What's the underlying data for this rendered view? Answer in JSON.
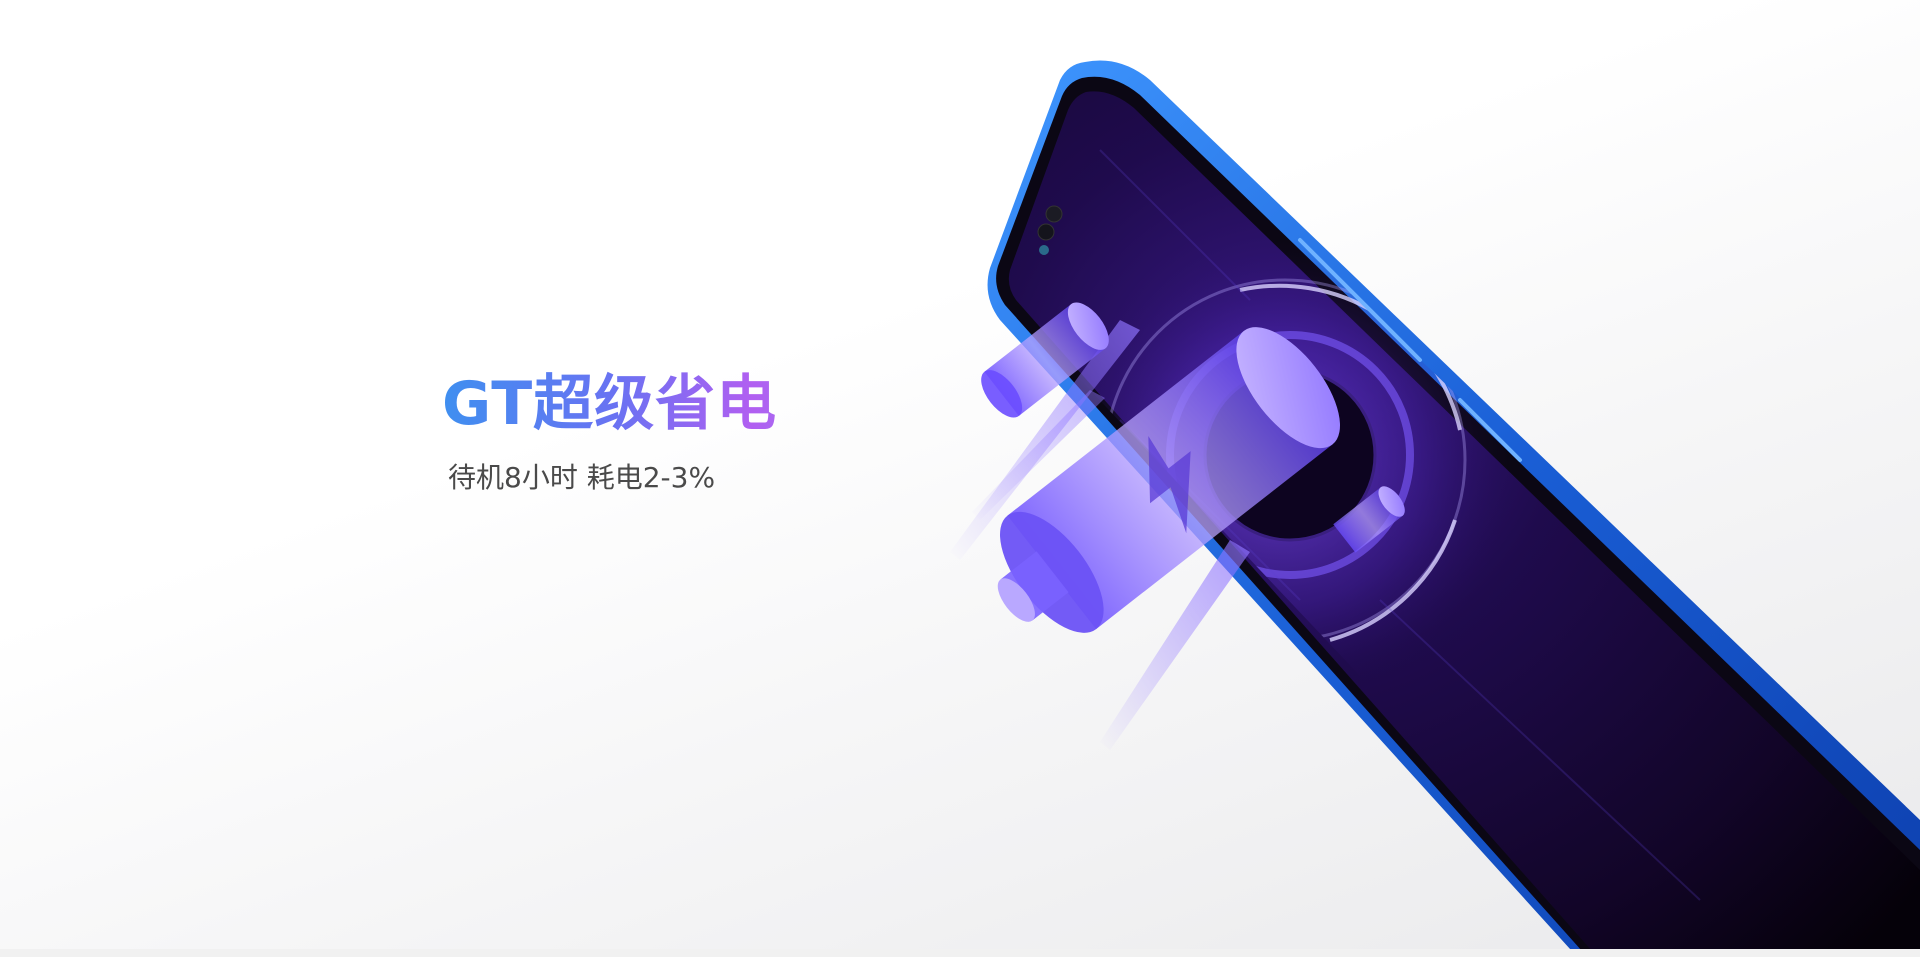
{
  "banner": {
    "headline": "GT超级省电",
    "subline": "待机8小时 耗电2-3%"
  },
  "colors": {
    "background": "#ffffff",
    "headline_gradient_start": "#3f8ff0",
    "headline_gradient_mid": "#b15ff1",
    "headline_gradient_end": "#7fa4f4",
    "subline_text": "#4a4a4a",
    "phone_frame": "#1e6fe0",
    "screen_glow": "#7a4cff"
  }
}
